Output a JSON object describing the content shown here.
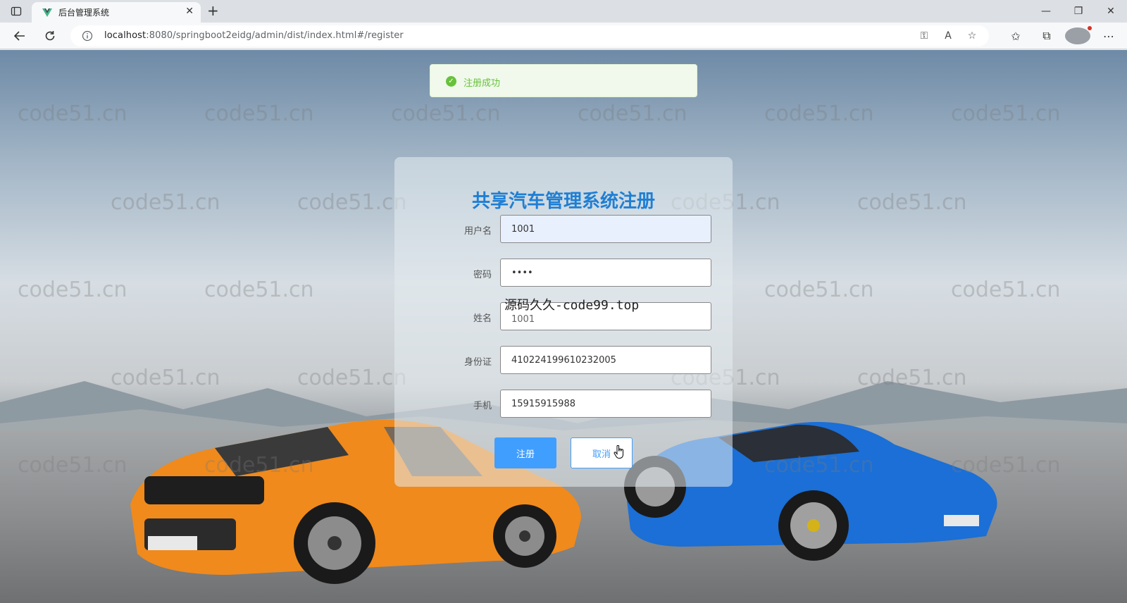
{
  "browser": {
    "tab_title": "后台管理系统",
    "tab_close": "✕",
    "new_tab": "+",
    "url_host": "localhost",
    "url_rest": ":8080/springboot2eidg/admin/dist/index.html#/register",
    "window_controls": {
      "minimize": "—",
      "restore": "❐",
      "close": "✕"
    }
  },
  "watermark_text": "code51.cn",
  "toast": {
    "message": "注册成功",
    "accent_color": "#67c23a"
  },
  "register": {
    "title": "共享汽车管理系统注册",
    "fields": [
      {
        "label": "用户名",
        "value": "1001"
      },
      {
        "label": "密码",
        "value": "••••"
      },
      {
        "label": "姓名",
        "value": "1001"
      },
      {
        "label": "身份证",
        "value": "410224199610232005"
      },
      {
        "label": "手机",
        "value": "15915915988"
      }
    ],
    "submit_label": "注册",
    "cancel_label": "取消"
  },
  "overlay_watermark": "源码久久-code99.top",
  "colors": {
    "primary": "#409eff",
    "title": "#1e7fd4",
    "car_orange": "#f08a1c",
    "car_blue": "#1b6fd6"
  }
}
